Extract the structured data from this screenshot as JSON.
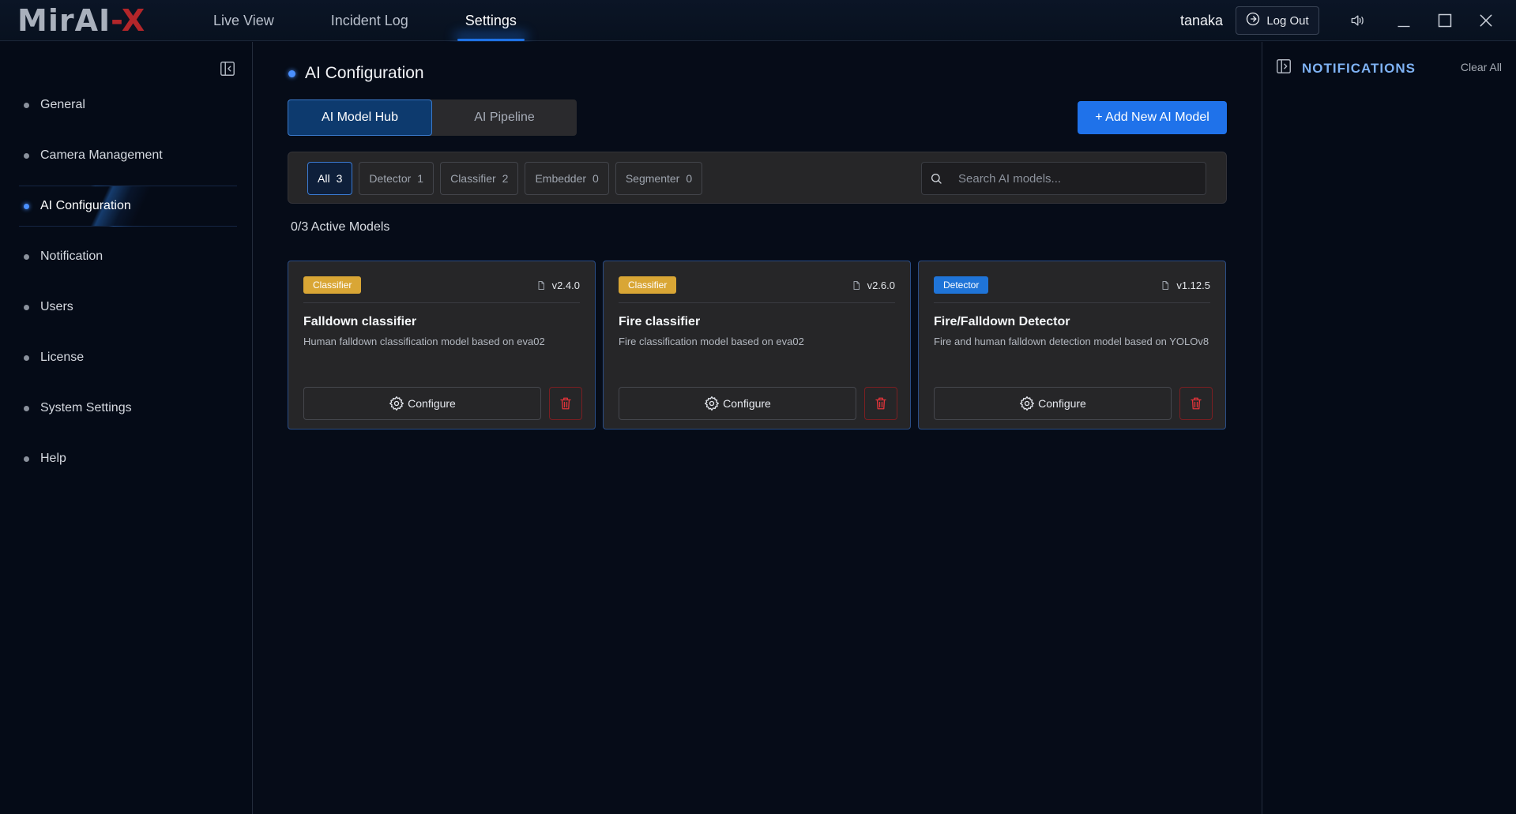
{
  "app": {
    "logo_part1": "Mir",
    "logo_part2": "AI",
    "logo_part3": "-X",
    "accent_color": "#1f72ea",
    "brand_red": "#c4262c"
  },
  "nav": {
    "items": [
      {
        "label": "Live View",
        "active": false
      },
      {
        "label": "Incident Log",
        "active": false
      },
      {
        "label": "Settings",
        "active": true
      }
    ]
  },
  "user": {
    "name": "tanaka",
    "logout_label": "Log Out"
  },
  "sidebar": {
    "items": [
      {
        "label": "General",
        "active": false
      },
      {
        "label": "Camera Management",
        "active": false
      },
      {
        "label": "AI Configuration",
        "active": true
      },
      {
        "label": "Notification",
        "active": false
      },
      {
        "label": "Users",
        "active": false
      },
      {
        "label": "License",
        "active": false
      },
      {
        "label": "System Settings",
        "active": false
      },
      {
        "label": "Help",
        "active": false
      }
    ]
  },
  "main": {
    "title": "AI Configuration",
    "tabs": [
      {
        "label": "AI Model Hub",
        "active": true
      },
      {
        "label": "AI Pipeline",
        "active": false
      }
    ],
    "add_button_label": "+ Add New AI Model",
    "filters": [
      {
        "label": "All",
        "count": "3",
        "active": true
      },
      {
        "label": "Detector",
        "count": "1",
        "active": false
      },
      {
        "label": "Classifier",
        "count": "2",
        "active": false
      },
      {
        "label": "Embedder",
        "count": "0",
        "active": false
      },
      {
        "label": "Segmenter",
        "count": "0",
        "active": false
      }
    ],
    "search": {
      "placeholder": "Search AI models...",
      "value": ""
    },
    "active_models": "0/3 Active Models",
    "models": [
      {
        "type": "Classifier",
        "type_color": "#d9a635",
        "version": "v2.4.0",
        "name": "Falldown classifier",
        "description": "Human falldown classification model based on eva02",
        "configure_label": "Configure"
      },
      {
        "type": "Classifier",
        "type_color": "#d9a635",
        "version": "v2.6.0",
        "name": "Fire classifier",
        "description": "Fire classification model based on eva02",
        "configure_label": "Configure"
      },
      {
        "type": "Detector",
        "type_color": "#1f74d8",
        "version": "v1.12.5",
        "name": "Fire/Falldown Detector",
        "description": "Fire and human falldown detection model based on YOLOv8",
        "configure_label": "Configure"
      }
    ]
  },
  "notifications": {
    "title": "NOTIFICATIONS",
    "clear_all_label": "Clear All",
    "items": []
  }
}
